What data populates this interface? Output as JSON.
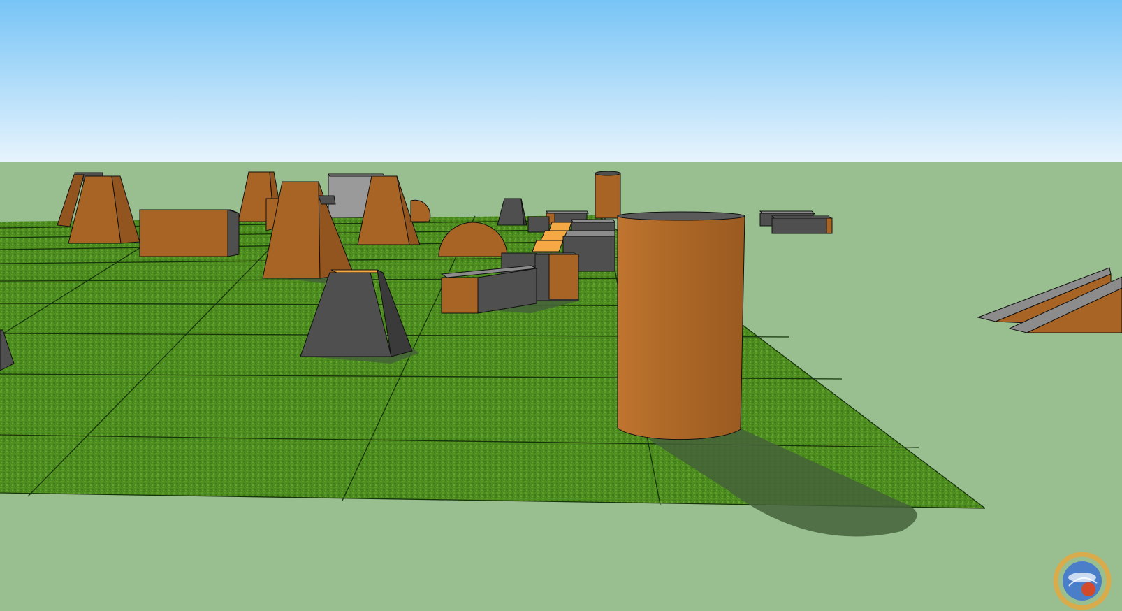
{
  "scene": {
    "type": "3d-model-viewport",
    "colors": {
      "sky_top": "#77c4f6",
      "sky_bottom": "#e7f4fd",
      "ground": "#99bf91",
      "field": "#4a8a1e",
      "field_light": "#5f9e2a",
      "grid_line": "#1d3d0c",
      "orange": "#a86424",
      "orange_dark": "#935520",
      "orange_light": "#f5a945",
      "gray": "#4f4f4f",
      "gray_dark": "#3a3a3a",
      "gray_light": "#8c8c8c",
      "shadow": "#44623a",
      "edge": "#101010"
    },
    "obstacles": [
      {
        "name": "cylinder-large",
        "kind": "cylinder",
        "color": "orange"
      },
      {
        "name": "cylinder-far",
        "kind": "cylinder",
        "color": "orange"
      },
      {
        "name": "pyramid-left",
        "kind": "truncated-pyramid",
        "color": "orange"
      },
      {
        "name": "pyramid-center",
        "kind": "truncated-pyramid",
        "color": "orange"
      },
      {
        "name": "pyramid-back",
        "kind": "truncated-pyramid",
        "color": "orange"
      },
      {
        "name": "pyramid-right",
        "kind": "truncated-pyramid",
        "color": "orange"
      },
      {
        "name": "pyramid-gray-front",
        "kind": "truncated-pyramid",
        "color": "gray"
      },
      {
        "name": "box-long",
        "kind": "box",
        "color": "orange"
      },
      {
        "name": "box-snake",
        "kind": "box",
        "color": "gray"
      },
      {
        "name": "dome",
        "kind": "half-dome",
        "color": "orange"
      },
      {
        "name": "ramp-right",
        "kind": "ramp",
        "color": "orange"
      },
      {
        "name": "wall-gray",
        "kind": "wall",
        "color": "gray"
      }
    ]
  },
  "watermark": {
    "icon": "globe-logo-icon"
  }
}
